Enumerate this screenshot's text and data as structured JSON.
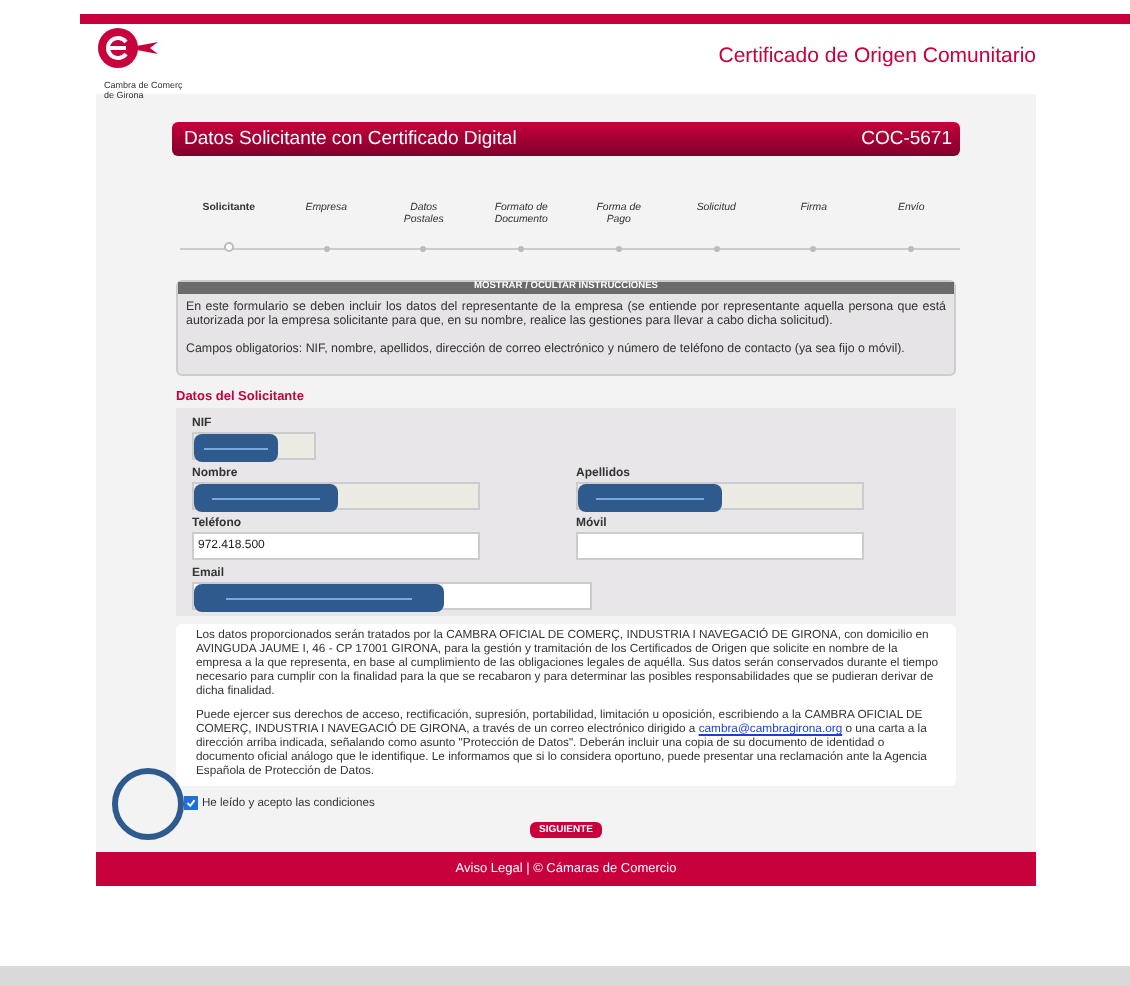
{
  "logo": {
    "lines": [
      "Cambra de Comerç",
      "de Girona"
    ]
  },
  "site_title": "Certificado de Origen Comunitario",
  "header": {
    "title": "Datos Solicitante con Certificado Digital",
    "code": "COC-5671"
  },
  "steps": [
    {
      "label": "Solicitante",
      "selected": true
    },
    {
      "label": "Empresa",
      "selected": false
    },
    {
      "label": "Datos Postales",
      "selected": false
    },
    {
      "label": "Formato de Documento",
      "selected": false
    },
    {
      "label": "Forma de Pago",
      "selected": false
    },
    {
      "label": "Solicitud",
      "selected": false
    },
    {
      "label": "Firma",
      "selected": false
    },
    {
      "label": "Envío",
      "selected": false
    }
  ],
  "instructions": {
    "toggle": "MOSTRAR / OCULTAR INSTRUCCIONES",
    "paragraphs": [
      "En este formulario se deben incluir los datos del representante de la empresa (se entiende por representante aquella persona que está autorizada por la empresa solicitante para que, en su nombre, realice las gestiones para llevar a cabo dicha solicitud).",
      "Campos obligatorios: NIF, nombre, apellidos, dirección de correo electrónico y número de teléfono de contacto (ya sea fijo o móvil)."
    ]
  },
  "section_title": "Datos del Solicitante",
  "fields": [
    {
      "label": "NIF",
      "redacted": true,
      "disabled": true
    },
    {
      "label": "Nombre",
      "redacted": true,
      "disabled": true
    },
    {
      "label": "Apellidos",
      "redacted": true,
      "disabled": true
    },
    {
      "label": "Teléfono",
      "value": "972.418.500",
      "redacted": false,
      "disabled": false
    },
    {
      "label": "Móvil",
      "redacted": false,
      "disabled": false
    },
    {
      "label": "Email",
      "redacted": true,
      "disabled": false
    }
  ],
  "legal": {
    "paragraph_1": "Los datos proporcionados serán tratados por la CAMBRA OFICIAL DE COMERÇ, INDUSTRIA I NAVEGACIÓ DE GIRONA, con domicilio en AVINGUDA JAUME I, 46 - CP 17001 GIRONA, para la gestión y tramitación de los Certificados de Origen que solicite en nombre de la empresa a la que representa, en base al cumplimiento de las obligaciones legales de aquélla. Sus datos serán conservados durante el tiempo necesario para cumplir con la finalidad para la que se recabaron y para determinar las posibles responsabilidades que se pudieran derivar de dicha finalidad.",
    "paragraph_2_before": "Puede ejercer sus derechos de acceso, rectificación, supresión, portabilidad, limitación u oposición, escribiendo a la CAMBRA OFICIAL DE COMERÇ, INDUSTRIA I NAVEGACIÓ DE GIRONA, a través de un correo electrónico dirigido a",
    "paragraph_2_link": "cambra@cambragirona.org",
    "paragraph_2_after": "o una carta a la dirección arriba indicada, señalando como asunto \"Protección de Datos\". Deberán incluir una copia de su documento de identidad o documento oficial análogo que le identifique. Le informamos que si lo considera oportuno, puede presentar una reclamación ante la Agencia Española de Protección de Datos."
  },
  "accept": {
    "label": "He leído y acepto las condiciones",
    "checked": true
  },
  "next_button": "SIGUIENTE",
  "footer": "Aviso Legal | © Cámaras de Comercio"
}
